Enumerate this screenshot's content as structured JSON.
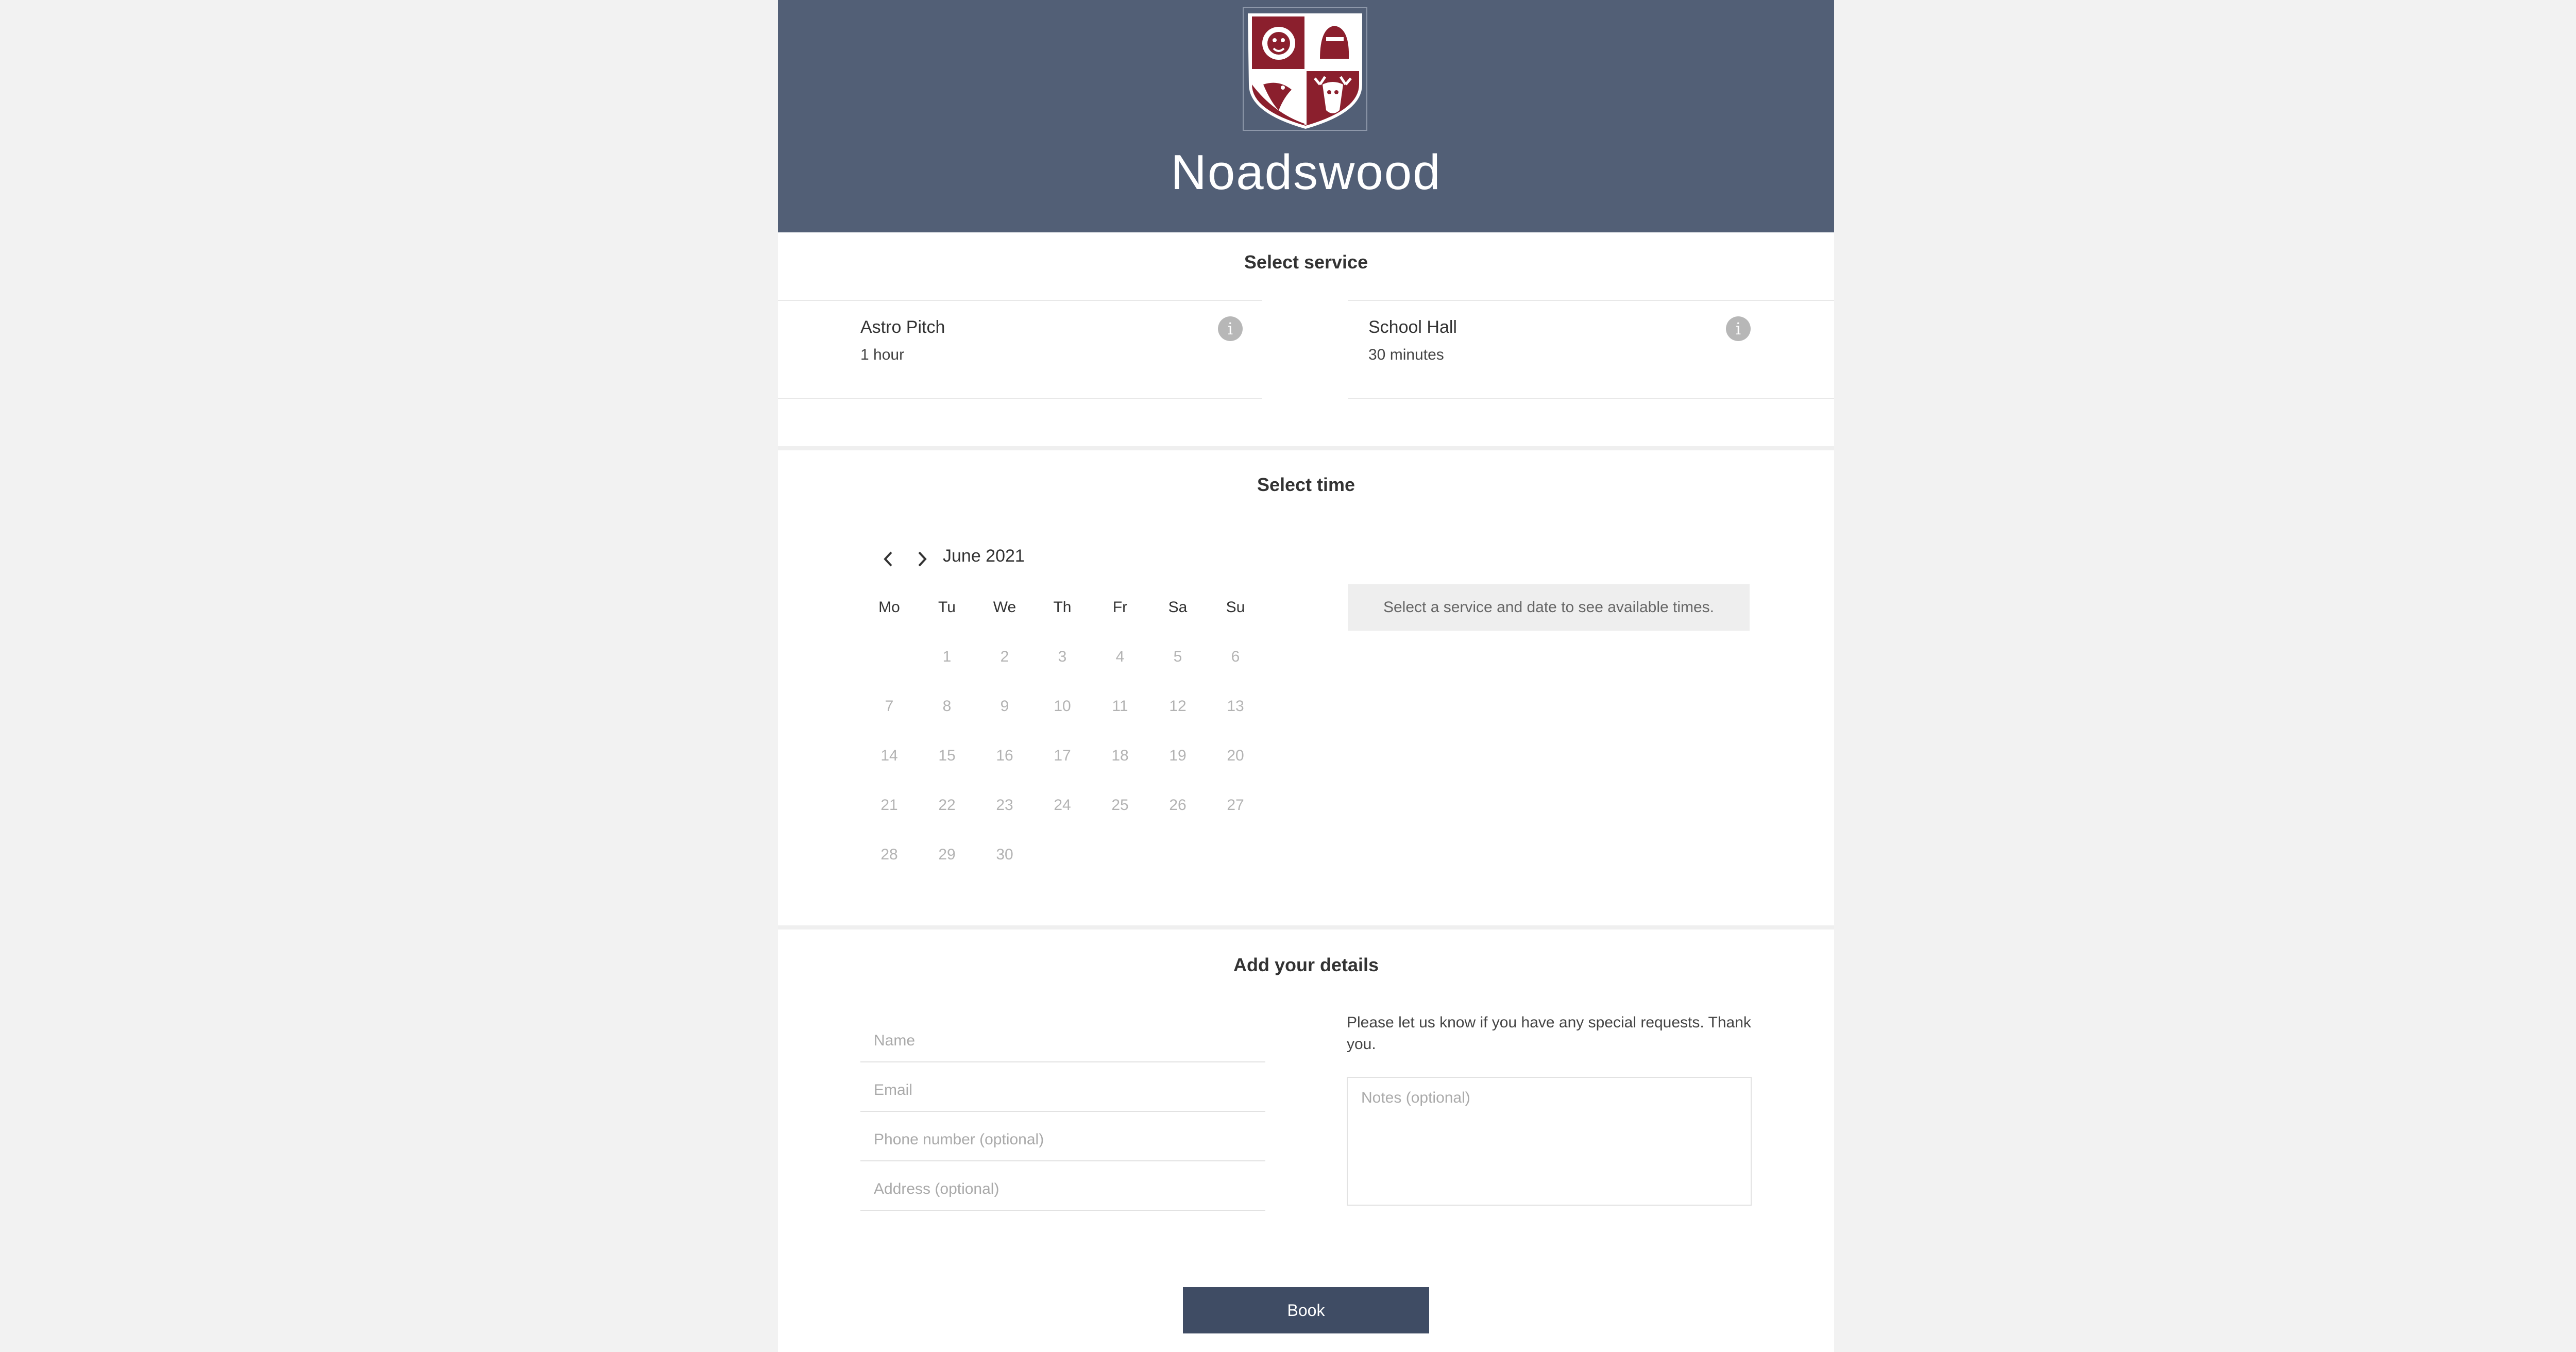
{
  "header": {
    "brand_name": "Noadswood",
    "crest_icon": "school-crest-logo",
    "background_color": "#525f76"
  },
  "services": {
    "title": "Select service",
    "items": [
      {
        "name": "Astro Pitch",
        "duration": "1 hour",
        "info_icon": "info-icon",
        "info_glyph": "i"
      },
      {
        "name": "School Hall",
        "duration": "30 minutes",
        "info_icon": "info-icon",
        "info_glyph": "i"
      }
    ]
  },
  "time": {
    "title": "Select time",
    "month": "June 2021",
    "prev_icon": "chevron-left-icon",
    "next_icon": "chevron-right-icon",
    "weekdays": [
      "Mo",
      "Tu",
      "We",
      "Th",
      "Fr",
      "Sa",
      "Su"
    ],
    "first_weekday_offset": 1,
    "days": [
      "1",
      "2",
      "3",
      "4",
      "5",
      "6",
      "7",
      "8",
      "9",
      "10",
      "11",
      "12",
      "13",
      "14",
      "15",
      "16",
      "17",
      "18",
      "19",
      "20",
      "21",
      "22",
      "23",
      "24",
      "25",
      "26",
      "27",
      "28",
      "29",
      "30"
    ],
    "availability_note": "Select a service and date to see available times."
  },
  "details": {
    "title": "Add your details",
    "fields": {
      "name_placeholder": "Name",
      "email_placeholder": "Email",
      "phone_placeholder": "Phone number (optional)",
      "address_placeholder": "Address (optional)"
    },
    "requests_text": "Please let us know if you have any special requests. Thank you.",
    "notes_placeholder": "Notes (optional)",
    "book_label": "Book",
    "book_color": "#3f4c64"
  }
}
